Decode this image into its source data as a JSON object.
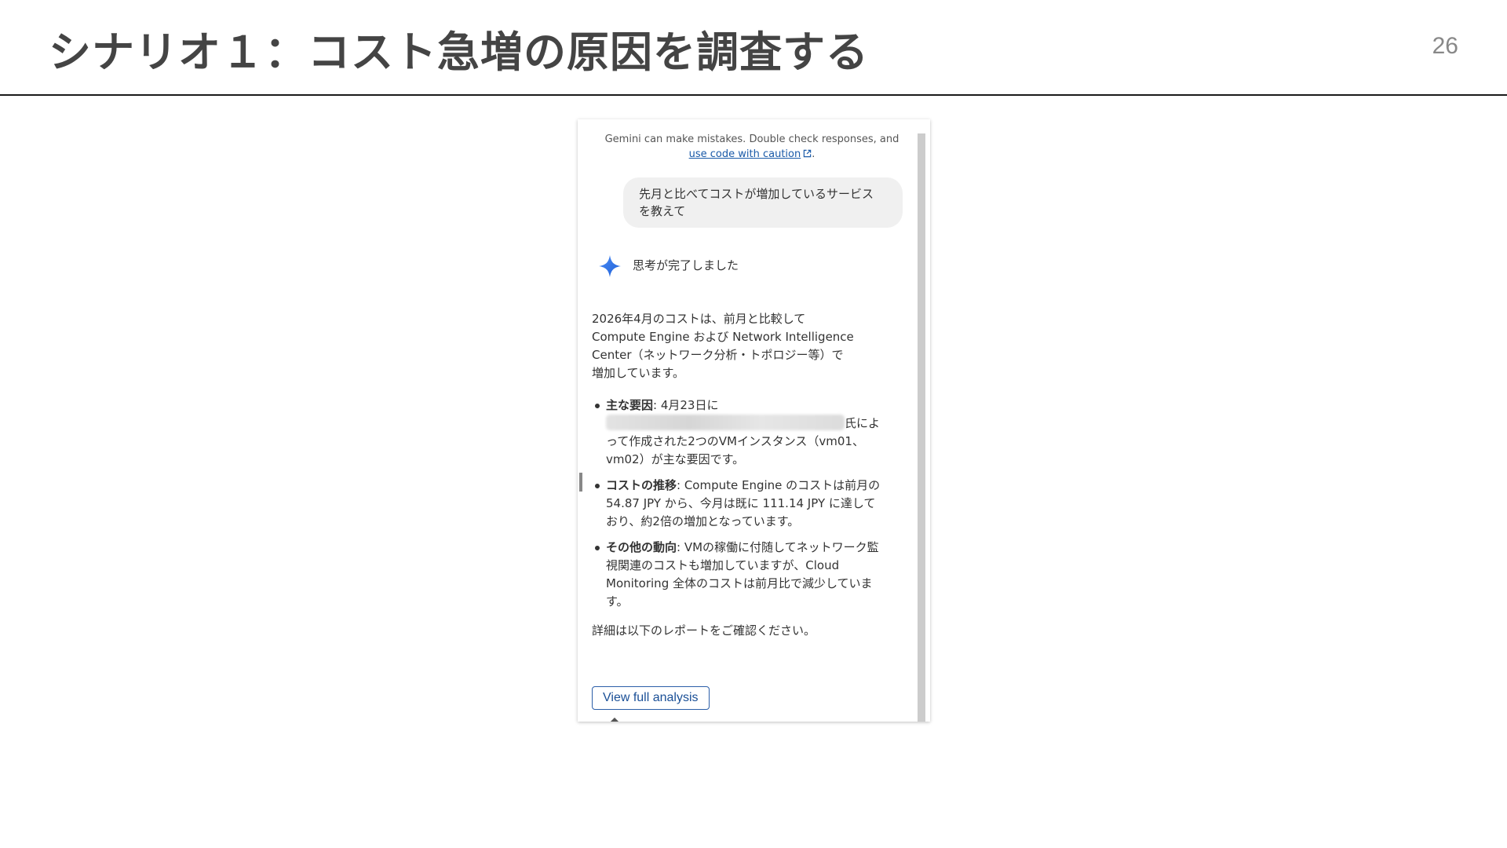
{
  "slide": {
    "title": "シナリオ１：コスト急増の原因を調査する",
    "page_number": "26"
  },
  "panel": {
    "disclaimer": {
      "text": "Gemini can make mistakes. Double check responses, and ",
      "link_text": "use code with caution",
      "suffix": "."
    },
    "user_message": "先月と比べてコストが増加しているサービス\nを教えて",
    "thinking_status": "思考が完了しました",
    "response": {
      "intro": "2026年4月のコストは、前月と比較して\nCompute Engine および Network Intelligence\nCenter（ネットワーク分析・トポロジー等）で\n増加しています。",
      "bullets": [
        {
          "heading": "主な要因",
          "text_before": ": 4月23日に",
          "text_after": "氏によって作成された2つのVMインスタンス（vm01、vm02）が主な要因です。"
        },
        {
          "heading": "コストの推移",
          "text_before": ": Compute Engine のコストは前月の 54.87 JPY から、今月は既に 111.14 JPY に達しており、約2倍の増加となっています。"
        },
        {
          "heading": "その他の動向",
          "text_before": ": VMの稼働に付随してネットワーク監視関連のコストも増加していますが、Cloud Monitoring 全体のコストは前月比で減少しています。"
        }
      ],
      "closing": "詳細は以下のレポートをご確認ください。"
    },
    "action_button_label": "View full analysis",
    "colors": {
      "link": "#1a5aa8",
      "gemini_star_start": "#4c8df6",
      "gemini_star_end": "#1e5fd6",
      "button_border": "#2b5ea8"
    }
  }
}
